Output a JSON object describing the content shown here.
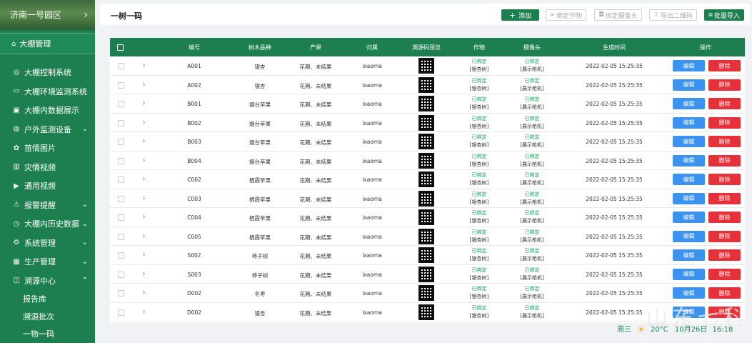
{
  "sidebar": {
    "location": "济南一号园区",
    "selected": "大棚管理",
    "items": [
      {
        "label": "大棚控制系统",
        "icon": "gear-circle-icon",
        "glyph": "◎",
        "arrow": ""
      },
      {
        "label": "大棚环境监测系统",
        "icon": "monitor-icon",
        "glyph": "▭",
        "arrow": ""
      },
      {
        "label": "大棚内数据展示",
        "icon": "chart-box-icon",
        "glyph": "▣",
        "arrow": ""
      },
      {
        "label": "户外监测设备",
        "icon": "location-icon",
        "glyph": "◍",
        "arrow": "⌄"
      },
      {
        "label": "苗情图片",
        "icon": "sprout-icon",
        "glyph": "✿",
        "arrow": ""
      },
      {
        "label": "灾情视频",
        "icon": "bar-chart-icon",
        "glyph": "▥",
        "arrow": ""
      },
      {
        "label": "通用视频",
        "icon": "video-icon",
        "glyph": "▶",
        "arrow": ""
      },
      {
        "label": "报警提醒",
        "icon": "warning-icon",
        "glyph": "⚠",
        "arrow": "⌄"
      },
      {
        "label": "大棚内历史数据",
        "icon": "clock-icon",
        "glyph": "◷",
        "arrow": "⌄"
      },
      {
        "label": "系统管理",
        "icon": "settings-icon",
        "glyph": "⚙",
        "arrow": "⌄"
      },
      {
        "label": "生产管理",
        "icon": "grid-icon",
        "glyph": "▦",
        "arrow": "⌄"
      },
      {
        "label": "溯源中心",
        "icon": "trace-icon",
        "glyph": "◫",
        "arrow": "⌃"
      }
    ],
    "subitems": [
      "报告库",
      "溯源批次",
      "一物一码"
    ]
  },
  "header": {
    "title": "一树一码",
    "add": "添加",
    "bind_crop": "绑定作物",
    "bind_camera": "绑定摄像头",
    "export_qr": "导出二维码",
    "batch_import": "批量导入"
  },
  "table": {
    "columns": [
      "编号",
      "树木品种",
      "产果",
      "归属",
      "溯源码预览",
      "作物",
      "摄像头",
      "生成时间",
      "操作"
    ],
    "edit": "编辑",
    "delete": "删除",
    "bound": "已绑定",
    "crop_note": "[银杏树]",
    "cam_note": "[展示枪机]",
    "rows": [
      {
        "id": "A001",
        "variety": "银杏",
        "fruit": "花期、未结果",
        "owner": "ixaoma",
        "time": "2022-02-05  15:25:35"
      },
      {
        "id": "A002",
        "variety": "银杏",
        "fruit": "花期、未结果",
        "owner": "ixaoma",
        "time": "2022-02-05  15:25:35"
      },
      {
        "id": "B001",
        "variety": "烟台苹果",
        "fruit": "花期、未结果",
        "owner": "ixaoma",
        "time": "2022-02-05  15:25:35"
      },
      {
        "id": "B002",
        "variety": "烟台苹果",
        "fruit": "花期、未结果",
        "owner": "ixaoma",
        "time": "2022-02-05  15:25:35"
      },
      {
        "id": "B003",
        "variety": "烟台苹果",
        "fruit": "花期、未结果",
        "owner": "ixaoma",
        "time": "2022-02-05  15:25:35"
      },
      {
        "id": "B004",
        "variety": "烟台苹果",
        "fruit": "花期、未结果",
        "owner": "ixaoma",
        "time": "2022-02-05  15:25:35"
      },
      {
        "id": "C002",
        "variety": "栖霞苹果",
        "fruit": "花期、未结果",
        "owner": "ixaoma",
        "time": "2022-02-05  15:25:35"
      },
      {
        "id": "C003",
        "variety": "栖霞苹果",
        "fruit": "花期、未结果",
        "owner": "ixaoma",
        "time": "2022-02-05  15:25:35"
      },
      {
        "id": "C004",
        "variety": "栖霞苹果",
        "fruit": "花期、未结果",
        "owner": "ixaoma",
        "time": "2022-02-05  15:25:35"
      },
      {
        "id": "C005",
        "variety": "栖霞苹果",
        "fruit": "花期、未结果",
        "owner": "ixaoma",
        "time": "2022-02-05  15:25:35"
      },
      {
        "id": "S002",
        "variety": "柿子树",
        "fruit": "花期、未结果",
        "owner": "ixaoma",
        "time": "2022-02-05  15:25:35"
      },
      {
        "id": "S003",
        "variety": "柿子树",
        "fruit": "花期、未结果",
        "owner": "ixaoma",
        "time": "2022-02-05  15:25:35"
      },
      {
        "id": "D002",
        "variety": "冬枣",
        "fruit": "花期、未结果",
        "owner": "ixaoma",
        "time": "2022-02-05  15:25:35"
      },
      {
        "id": "D002",
        "variety": "银杏",
        "fruit": "花期、未结果",
        "owner": "ixaoma",
        "time": "2022-02-05  15:25:35"
      }
    ]
  },
  "footer": {
    "weekday": "周三",
    "temp": "20°C",
    "date": "10月26日",
    "time": "16:18"
  },
  "watermark": "山东七科",
  "colors": {
    "brand": "#1d7f4f",
    "edit": "#3b93ef",
    "delete": "#e5323a"
  }
}
